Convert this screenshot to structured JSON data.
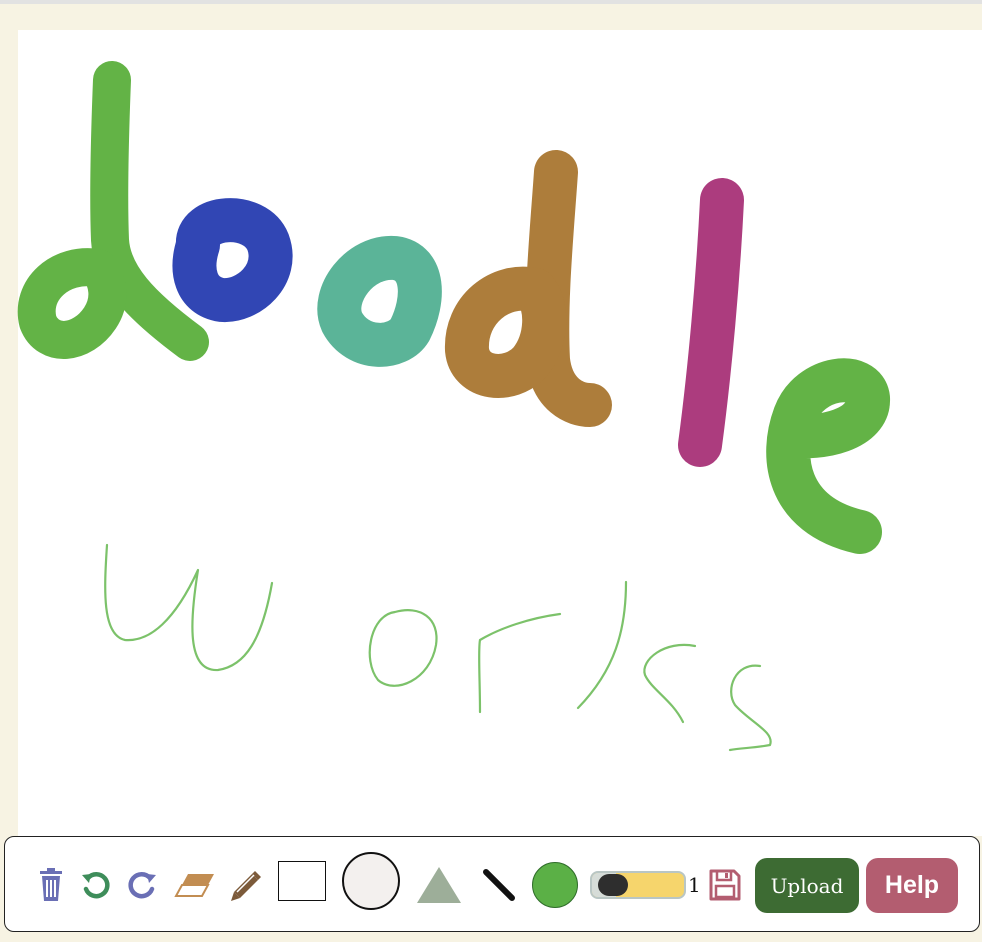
{
  "toolbar": {
    "upload_label": "Upload",
    "help_label": "Help",
    "brush_size": "1",
    "icons": [
      "trash-icon",
      "undo-icon",
      "redo-icon",
      "eraser-icon",
      "pencil-icon",
      "rectangle-tool",
      "circle-tool",
      "triangle-tool",
      "line-tool",
      "color-picker",
      "fill-toggle",
      "save-icon"
    ],
    "selected_color": "#5bb046"
  },
  "colors": {
    "green": "#63b346",
    "blue": "#3146b4",
    "teal": "#5bb498",
    "brown": "#ad7d3b",
    "magenta": "#ac3c7e",
    "thin_green": "#7cc26a"
  }
}
